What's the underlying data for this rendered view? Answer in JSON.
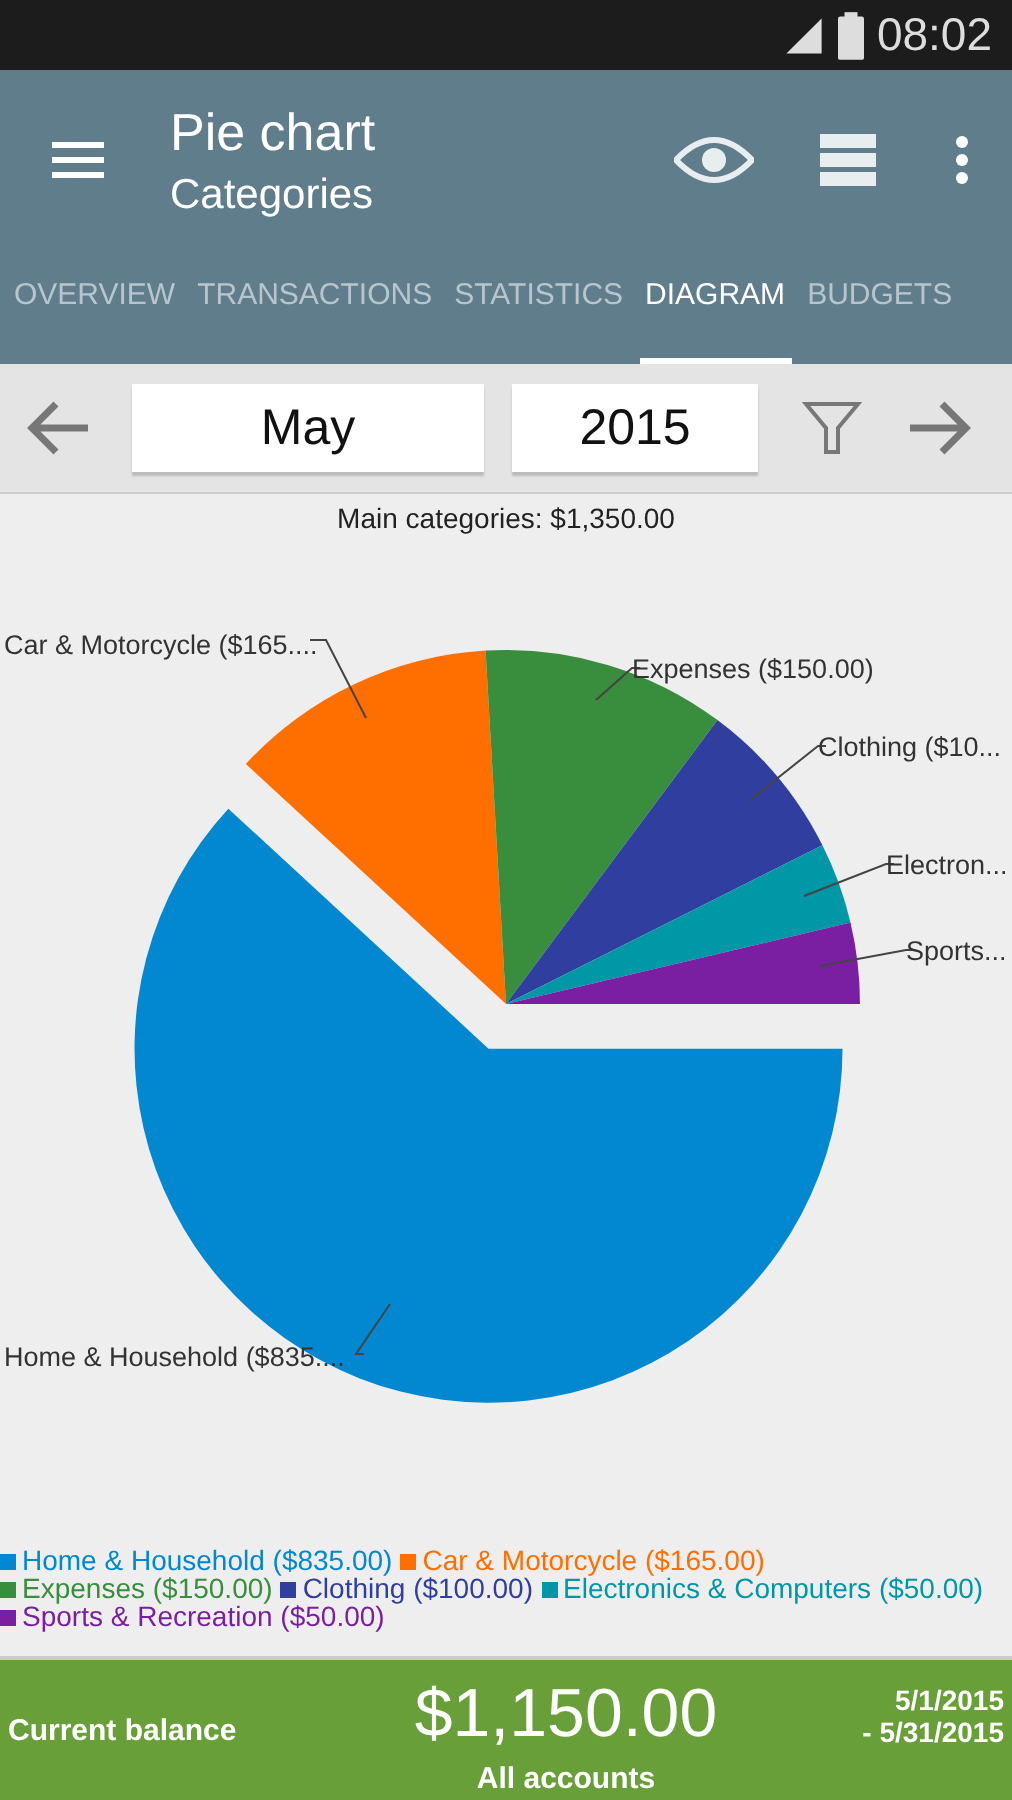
{
  "status_bar": {
    "time": "08:02"
  },
  "toolbar": {
    "title": "Pie chart",
    "subtitle": "Categories"
  },
  "tabs": [
    {
      "label": "OVERVIEW",
      "selected": false
    },
    {
      "label": "TRANSACTIONS",
      "selected": false
    },
    {
      "label": "STATISTICS",
      "selected": false
    },
    {
      "label": "DIAGRAM",
      "selected": true
    },
    {
      "label": "BUDGETS",
      "selected": false
    }
  ],
  "period": {
    "month": "May",
    "year": "2015"
  },
  "chart": {
    "chart_data": {
      "type": "pie",
      "title": "Main categories: $1,350.00",
      "categories": [
        "Home & Household ($835.00)",
        "Car & Motorcycle ($165.00)",
        "Expenses ($150.00)",
        "Clothing ($100.00)",
        "Electronics & Computers ($50.00)",
        "Sports & Recreation ($50.00)"
      ],
      "values": [
        61.86,
        12.22,
        11.11,
        7.41,
        3.7,
        3.7
      ]
    },
    "slices": [
      {
        "color": "#0288d1",
        "exploded": true
      },
      {
        "color": "#ff6f00",
        "exploded": false
      },
      {
        "color": "#388e3c",
        "exploded": false
      },
      {
        "color": "#303f9f",
        "exploded": false
      },
      {
        "color": "#0097a7",
        "exploded": false
      },
      {
        "color": "#7b1fa2",
        "exploded": false
      }
    ],
    "callouts": [
      "Car & Motorcycle ($165....",
      "Expenses ($150.00)",
      "Clothing ($10...",
      "Electron...",
      "Sports...",
      "Home & Household ($835...."
    ]
  },
  "footer": {
    "label": "Current balance",
    "amount": "$1,150.00",
    "accounts": "All accounts",
    "date_from": "5/1/2015",
    "date_to": "- 5/31/2015"
  }
}
